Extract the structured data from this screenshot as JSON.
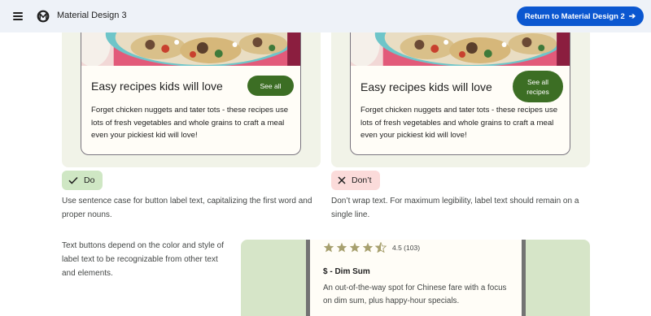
{
  "topbar": {
    "app_title": "Material Design 3",
    "menu_icon": "menu-icon",
    "logo_icon": "material-logo-icon",
    "return_label": "Return to Material Design 2",
    "return_icon": "arrow-right-icon",
    "return_color": "#0b57d0"
  },
  "examples": {
    "do": {
      "card_title": "Easy recipes kids will love",
      "button_label": "See all",
      "card_body": "Forget chicken nuggets and tater tots - these recipes use lots of fresh vegetables and whole grains to craft a meal even your pickiest kid will love!",
      "chip_label": "Do",
      "chip_icon": "check-icon",
      "chip_color": "#cfe7c4",
      "description": "Use sentence case for button label text, capitalizing the first word and proper nouns."
    },
    "dont": {
      "card_title": "Easy recipes kids will love",
      "button_label": "See all recipes",
      "card_body": "Forget chicken nuggets and tater tots - these recipes use lots of fresh vegetables and whole grains to craft a meal even your pickiest kid will love!",
      "chip_label": "Don’t",
      "chip_icon": "close-icon",
      "chip_color": "#fbdbda",
      "description": "Don’t wrap text. For maximum legibility, label text should remain on a single line."
    },
    "button_color": "#3c6e24"
  },
  "text_buttons": {
    "description": "Text buttons depend on the color and style of label text to be recognizable from other text and elements.",
    "rating": {
      "stars": 4.5,
      "value_label": "4.5 (103)"
    },
    "place_title": "$ - Dim Sum",
    "place_description": "An out-of-the-way spot for Chinese fare with a focus on dim sum, plus happy-hour specials."
  }
}
